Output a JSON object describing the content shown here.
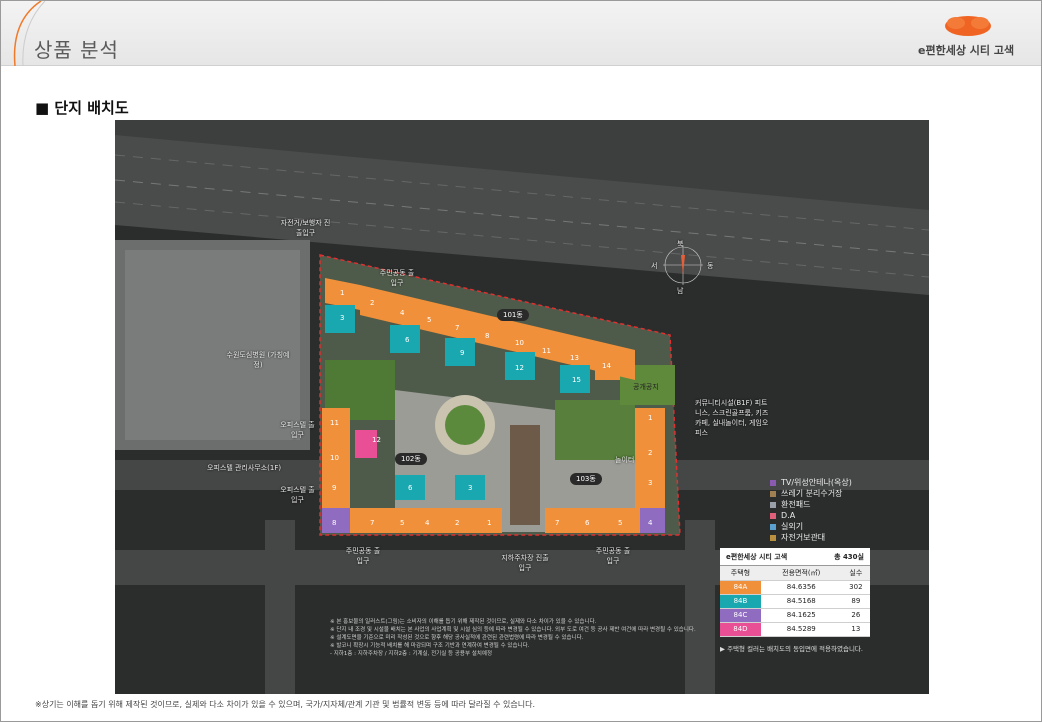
{
  "header": {
    "page_title": "상품 분석",
    "brand_name": "e편한세상 시티 고색"
  },
  "section": {
    "title": "■ 단지 배치도"
  },
  "site_plan": {
    "buildings": {
      "b101": "101동",
      "b102": "102동",
      "b103": "103동"
    },
    "compass": {
      "north": "북",
      "south": "남",
      "east": "동",
      "west": "서"
    },
    "labels": {
      "hospital": "수원도심병원 (가칭예정)",
      "office_mgmt": "오피스텔 관리사무소(1F)",
      "community": "커뮤니티시설(B1F) 피트니스, 스크린골프룸, 키즈카페, 실내놀이터, 게임오피스",
      "car_entrance_top": "자전거/보행자 진출입구",
      "car_entrance_bottom": "지하주차장 진출입구",
      "pedestrian_1": "주민공동 출입구",
      "pedestrian_2": "주민공동 출입구",
      "pedestrian_3": "주민공동 출입구",
      "office_entrance_1": "오피스텔 출입구",
      "office_entrance_2": "오피스텔 출입구",
      "playground": "놀이터",
      "public_open": "공개공지"
    },
    "legend": [
      {
        "label": "TV/위성안테나(옥상)",
        "color": "#8a5bb0"
      },
      {
        "label": "쓰레기 분리수거장",
        "color": "#a08050"
      },
      {
        "label": "환전패드",
        "color": "#9aa0a8"
      },
      {
        "label": "D.A",
        "color": "#e0607a"
      },
      {
        "label": "실외기",
        "color": "#5aa0d0"
      },
      {
        "label": "자전거보관대",
        "color": "#b89040"
      }
    ],
    "unit_table": {
      "title": "e편한세상 시티 고색",
      "total": "총 430실",
      "headers": [
        "주택형",
        "전용면적(㎡)",
        "실수"
      ],
      "rows": [
        {
          "type": "84A",
          "area": "84.6356",
          "count": "302",
          "color": "#f0903a"
        },
        {
          "type": "84B",
          "area": "84.5168",
          "count": "89",
          "color": "#1aa8b0"
        },
        {
          "type": "84C",
          "area": "84.1625",
          "count": "26",
          "color": "#8f6cc0"
        },
        {
          "type": "84D",
          "area": "84.5289",
          "count": "13",
          "color": "#e84f95"
        }
      ],
      "note": "▶ 주택형 컬러는 배치도의 동입면에 적용하였습니다."
    },
    "notes": [
      "※ 본 홍보물의 일러스트(그림)는 소비자의 이해를 돕기 위해 제작된 것이므로, 실제와 다소 차이가 있을 수 있습니다.",
      "※ 단지 내 조경 및 시설물 배치는 본 사업의 사업계획 및 시설 심의 등에 따라 변경될 수 있습니다. 외부 도로 여건 등 공사 제반 여건에 따라 변경될 수 있습니다.",
      "※ 설계도면을 기준으로 미리 작성된 것으로 향후 해당 공사실적에 관련된 관련법령에 따라 변경될 수 있습니다.",
      "※ 발코니 확장시 기능적 배치를 해 마감되며 구조 기반과 연계하여 변경될 수 있습니다.",
      "  - 지하1층 : 지하주차장 / 지하2층 : 기계실, 전기실 등 공용부 설치예정"
    ]
  },
  "footer": {
    "note": "※상기는 이해를 돕기 위해 제작된 것이므로, 실제와 다소 차이가 있을 수 있으며, 국가/지자체/관계 기관 및 법률적 변동 등에 따라 달라질 수 있습니다."
  }
}
